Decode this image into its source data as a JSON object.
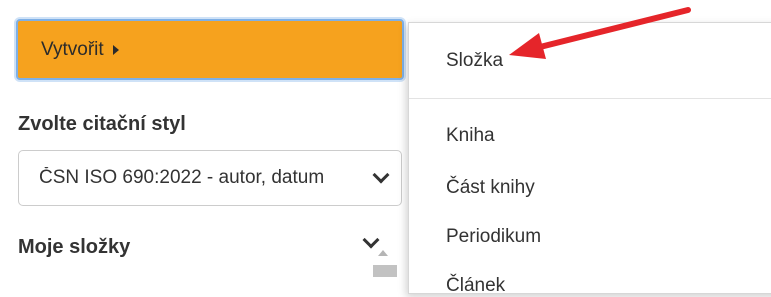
{
  "create_button": {
    "label": "Vytvořit"
  },
  "citation": {
    "label": "Zvolte citační styl",
    "selected": "ČSN ISO 690:2022 - autor, datum"
  },
  "folders": {
    "label": "Moje složky"
  },
  "menu": {
    "items": [
      {
        "label": "Složka"
      },
      {
        "label": "Kniha"
      },
      {
        "label": "Část knihy"
      },
      {
        "label": "Periodikum"
      },
      {
        "label": "Článek"
      }
    ]
  },
  "colors": {
    "create_button_bg": "#f6a21e",
    "focus_ring": "#7fb0e6",
    "annotation_arrow": "#e5252a"
  },
  "icons": {
    "create_caret": "caret-right-icon",
    "citation_select": "chevron-down-icon",
    "folders_toggle": "chevron-down-icon",
    "annotation": "red-arrow-icon"
  }
}
